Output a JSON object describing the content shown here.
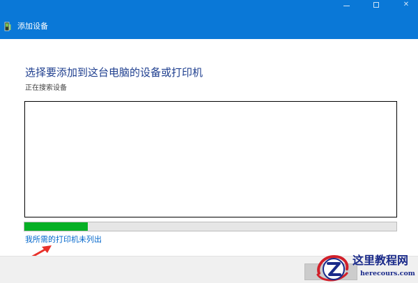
{
  "window": {
    "title": "添加设备",
    "controls": {
      "minimize_icon": "minimize-icon",
      "maximize_icon": "maximize-icon",
      "close_label": "✕"
    }
  },
  "main": {
    "heading": "选择要添加到这台电脑的设备或打印机",
    "status": "正在搜索设备",
    "devices": [],
    "progress": 0.17,
    "link_not_listed": "我所需的打印机未列出"
  },
  "footer": {
    "next_button_label": ""
  },
  "watermark": {
    "title": "这里教程网",
    "url": "herecours.com"
  },
  "colors": {
    "titlebar": "#0a78d7",
    "heading": "#1f3f8f",
    "link": "#0066cc",
    "progress_fill": "#06b025",
    "annotation_arrow": "#e8312a"
  }
}
